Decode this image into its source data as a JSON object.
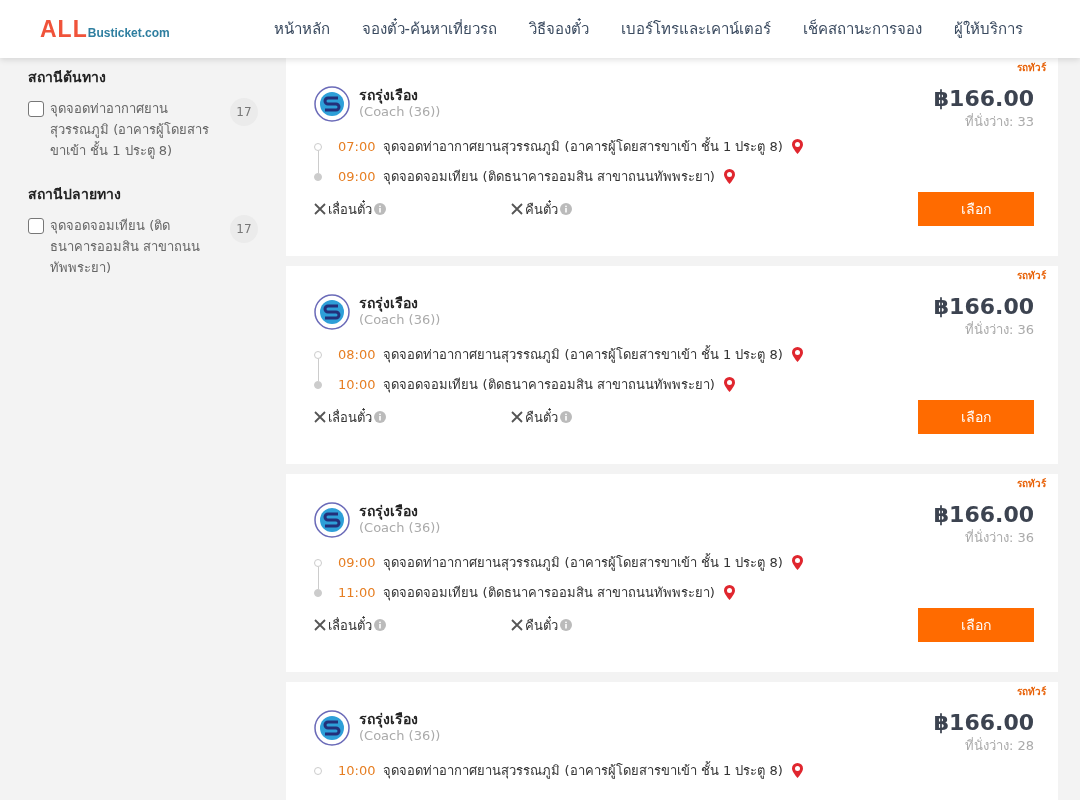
{
  "header": {
    "logo": {
      "brand": "ALL",
      "domain": "Busticket.com"
    },
    "nav": [
      "หน้าหลัก",
      "จองตั๋ว-ค้นหาเที่ยวรถ",
      "วิธีจองตั๋ว",
      "เบอร์โทรและเคาน์เตอร์",
      "เช็คสถานะการจอง",
      "ผู้ให้บริการ"
    ]
  },
  "filters": [
    {
      "title": "สถานีต้นทาง",
      "options": [
        {
          "label": "จุดจอดท่าอากาศยานสุวรรณภูมิ (อาคารผู้โดยสารขาเข้า ชั้น 1 ประตู 8)",
          "count": "17",
          "checked": false
        }
      ]
    },
    {
      "title": "สถานีปลายทาง",
      "options": [
        {
          "label": "จุดจอดจอมเทียน (ติดธนาคารออมสิน สาขาถนนทัพพระยา)",
          "count": "17",
          "checked": false
        }
      ]
    }
  ],
  "trips": [
    {
      "operator": "รถรุ่งเรือง",
      "bus_type": "(Coach (36))",
      "tag": "รถทัวร์",
      "price": "฿166.00",
      "seats": "ที่นั่งว่าง: 33",
      "stops": [
        {
          "kind": "origin",
          "time": "07:00",
          "place": "จุดจอดท่าอากาศยานสุวรรณภูมิ (อาคารผู้โดยสารขาเข้า ชั้น 1 ประตู 8)"
        },
        {
          "kind": "destination",
          "time": "09:00",
          "place": "จุดจอดจอมเทียน (ติดธนาคารออมสิน สาขาถนนทัพพระยา)"
        }
      ],
      "options": [
        "เลื่อนตั๋ว",
        "คืนตั๋ว"
      ],
      "button": "เลือก"
    },
    {
      "operator": "รถรุ่งเรือง",
      "bus_type": "(Coach (36))",
      "tag": "รถทัวร์",
      "price": "฿166.00",
      "seats": "ที่นั่งว่าง: 36",
      "stops": [
        {
          "kind": "origin",
          "time": "08:00",
          "place": "จุดจอดท่าอากาศยานสุวรรณภูมิ (อาคารผู้โดยสารขาเข้า ชั้น 1 ประตู 8)"
        },
        {
          "kind": "destination",
          "time": "10:00",
          "place": "จุดจอดจอมเทียน (ติดธนาคารออมสิน สาขาถนนทัพพระยา)"
        }
      ],
      "options": [
        "เลื่อนตั๋ว",
        "คืนตั๋ว"
      ],
      "button": "เลือก"
    },
    {
      "operator": "รถรุ่งเรือง",
      "bus_type": "(Coach (36))",
      "tag": "รถทัวร์",
      "price": "฿166.00",
      "seats": "ที่นั่งว่าง: 36",
      "stops": [
        {
          "kind": "origin",
          "time": "09:00",
          "place": "จุดจอดท่าอากาศยานสุวรรณภูมิ (อาคารผู้โดยสารขาเข้า ชั้น 1 ประตู 8)"
        },
        {
          "kind": "destination",
          "time": "11:00",
          "place": "จุดจอดจอมเทียน (ติดธนาคารออมสิน สาขาถนนทัพพระยา)"
        }
      ],
      "options": [
        "เลื่อนตั๋ว",
        "คืนตั๋ว"
      ],
      "button": "เลือก"
    },
    {
      "operator": "รถรุ่งเรือง",
      "bus_type": "(Coach (36))",
      "tag": "รถทัวร์",
      "price": "฿166.00",
      "seats": "ที่นั่งว่าง: 28",
      "stops": [
        {
          "kind": "origin",
          "time": "10:00",
          "place": "จุดจอดท่าอากาศยานสุวรรณภูมิ (อาคารผู้โดยสารขาเข้า ชั้น 1 ประตู 8)"
        }
      ]
    }
  ]
}
